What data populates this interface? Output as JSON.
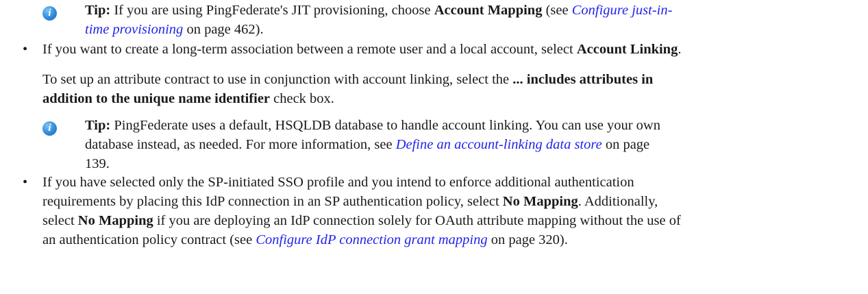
{
  "tip1": {
    "label": "Tip:",
    "pre": " If you are using PingFederate's JIT provisioning, choose ",
    "bold": "Account Mapping",
    "mid": " (see ",
    "link_a": "Configure just-in-",
    "link_b": "time provisioning",
    "post": " on page 462)."
  },
  "bullet1": {
    "marker": "•",
    "pre": "If you want to create a long-term association between a remote user and a local account, select ",
    "bold": "Account Linking",
    "post": "."
  },
  "para1": {
    "pre": "To set up an attribute contract to use in conjunction with account linking, select the ",
    "bold_a": "... includes attributes in",
    "bold_b": "addition to the unique name identifier",
    "post": " check box."
  },
  "tip2": {
    "label": "Tip:",
    "line1": " PingFederate uses a default, HSQLDB database to handle account linking. You can use your own",
    "line2_pre": "database instead, as needed. For more information, see ",
    "link": "Define an account-linking data store",
    "line2_post": " on page",
    "line3": "139."
  },
  "bullet2": {
    "marker": "•",
    "line1": "If you have selected only the SP-initiated SSO profile and you intend to enforce additional authentication",
    "line2_pre": "requirements by placing this IdP connection in an SP authentication policy, select ",
    "line2_bold": "No Mapping",
    "line2_post": ". Additionally,",
    "line3_pre": "select ",
    "line3_bold": "No Mapping",
    "line3_post": " if you are deploying an IdP connection solely for OAuth attribute mapping without the use of",
    "line4_pre": "an authentication policy contract (see ",
    "line4_link": "Configure IdP connection grant mapping",
    "line4_post": " on page 320)."
  },
  "icons": {
    "tip": "info-icon"
  },
  "colors": {
    "link": "#2222ee",
    "icon": "#2f8ad8"
  }
}
